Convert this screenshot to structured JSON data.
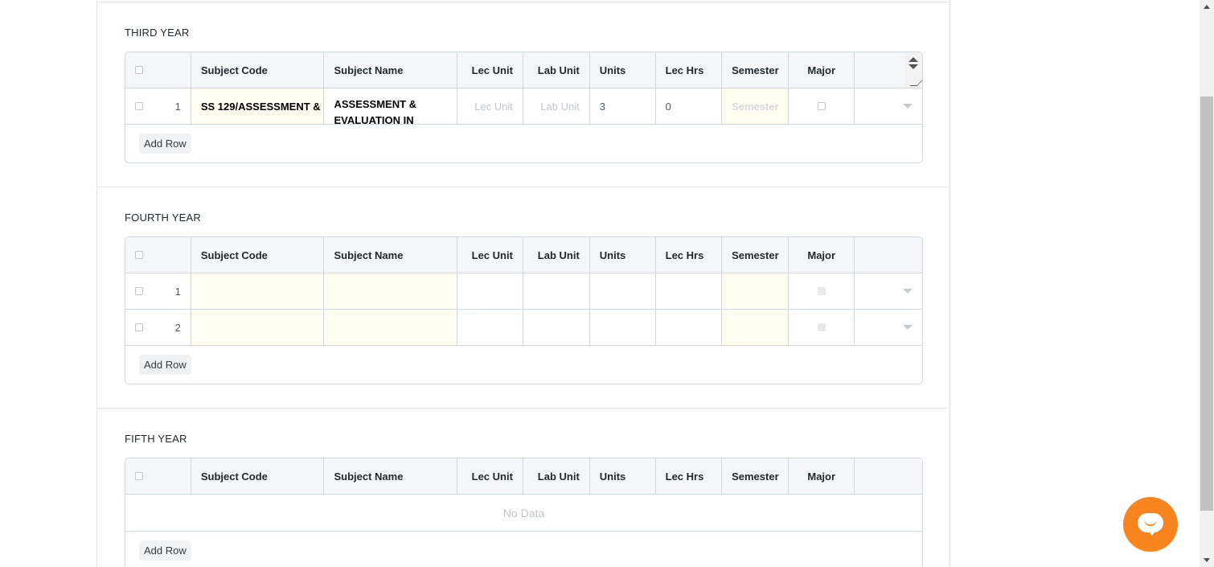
{
  "columns": {
    "subject_code": "Subject Code",
    "subject_name": "Subject Name",
    "lec_unit": "Lec Unit",
    "lab_unit": "Lab Unit",
    "units": "Units",
    "lec_hrs": "Lec Hrs",
    "semester": "Semester",
    "major": "Major"
  },
  "add_row_label": "Add Row",
  "no_data_label": "No Data",
  "third_year": {
    "title": "THIRD YEAR",
    "rows": [
      {
        "idx": "1",
        "subject_code": "SS 129/ASSESSMENT &",
        "subject_name": "ASSESSMENT & EVALUATION IN",
        "lec_unit_placeholder": "Lec Unit",
        "lab_unit_placeholder": "Lab Unit",
        "units": "3",
        "lec_hrs": "0",
        "semester_placeholder": "Semester"
      }
    ]
  },
  "fourth_year": {
    "title": "FOURTH YEAR",
    "rows": [
      {
        "idx": "1"
      },
      {
        "idx": "2"
      }
    ]
  },
  "fifth_year": {
    "title": "FIFTH YEAR"
  },
  "colors": {
    "accent_chat": "#f7841e",
    "grid_border": "#d1d8dd",
    "header_bg": "#f4f6f9",
    "required_bg": "#fffdf0"
  },
  "icons": {
    "chat": "chat-bubble-icon",
    "dropdown": "chevron-down-icon"
  }
}
